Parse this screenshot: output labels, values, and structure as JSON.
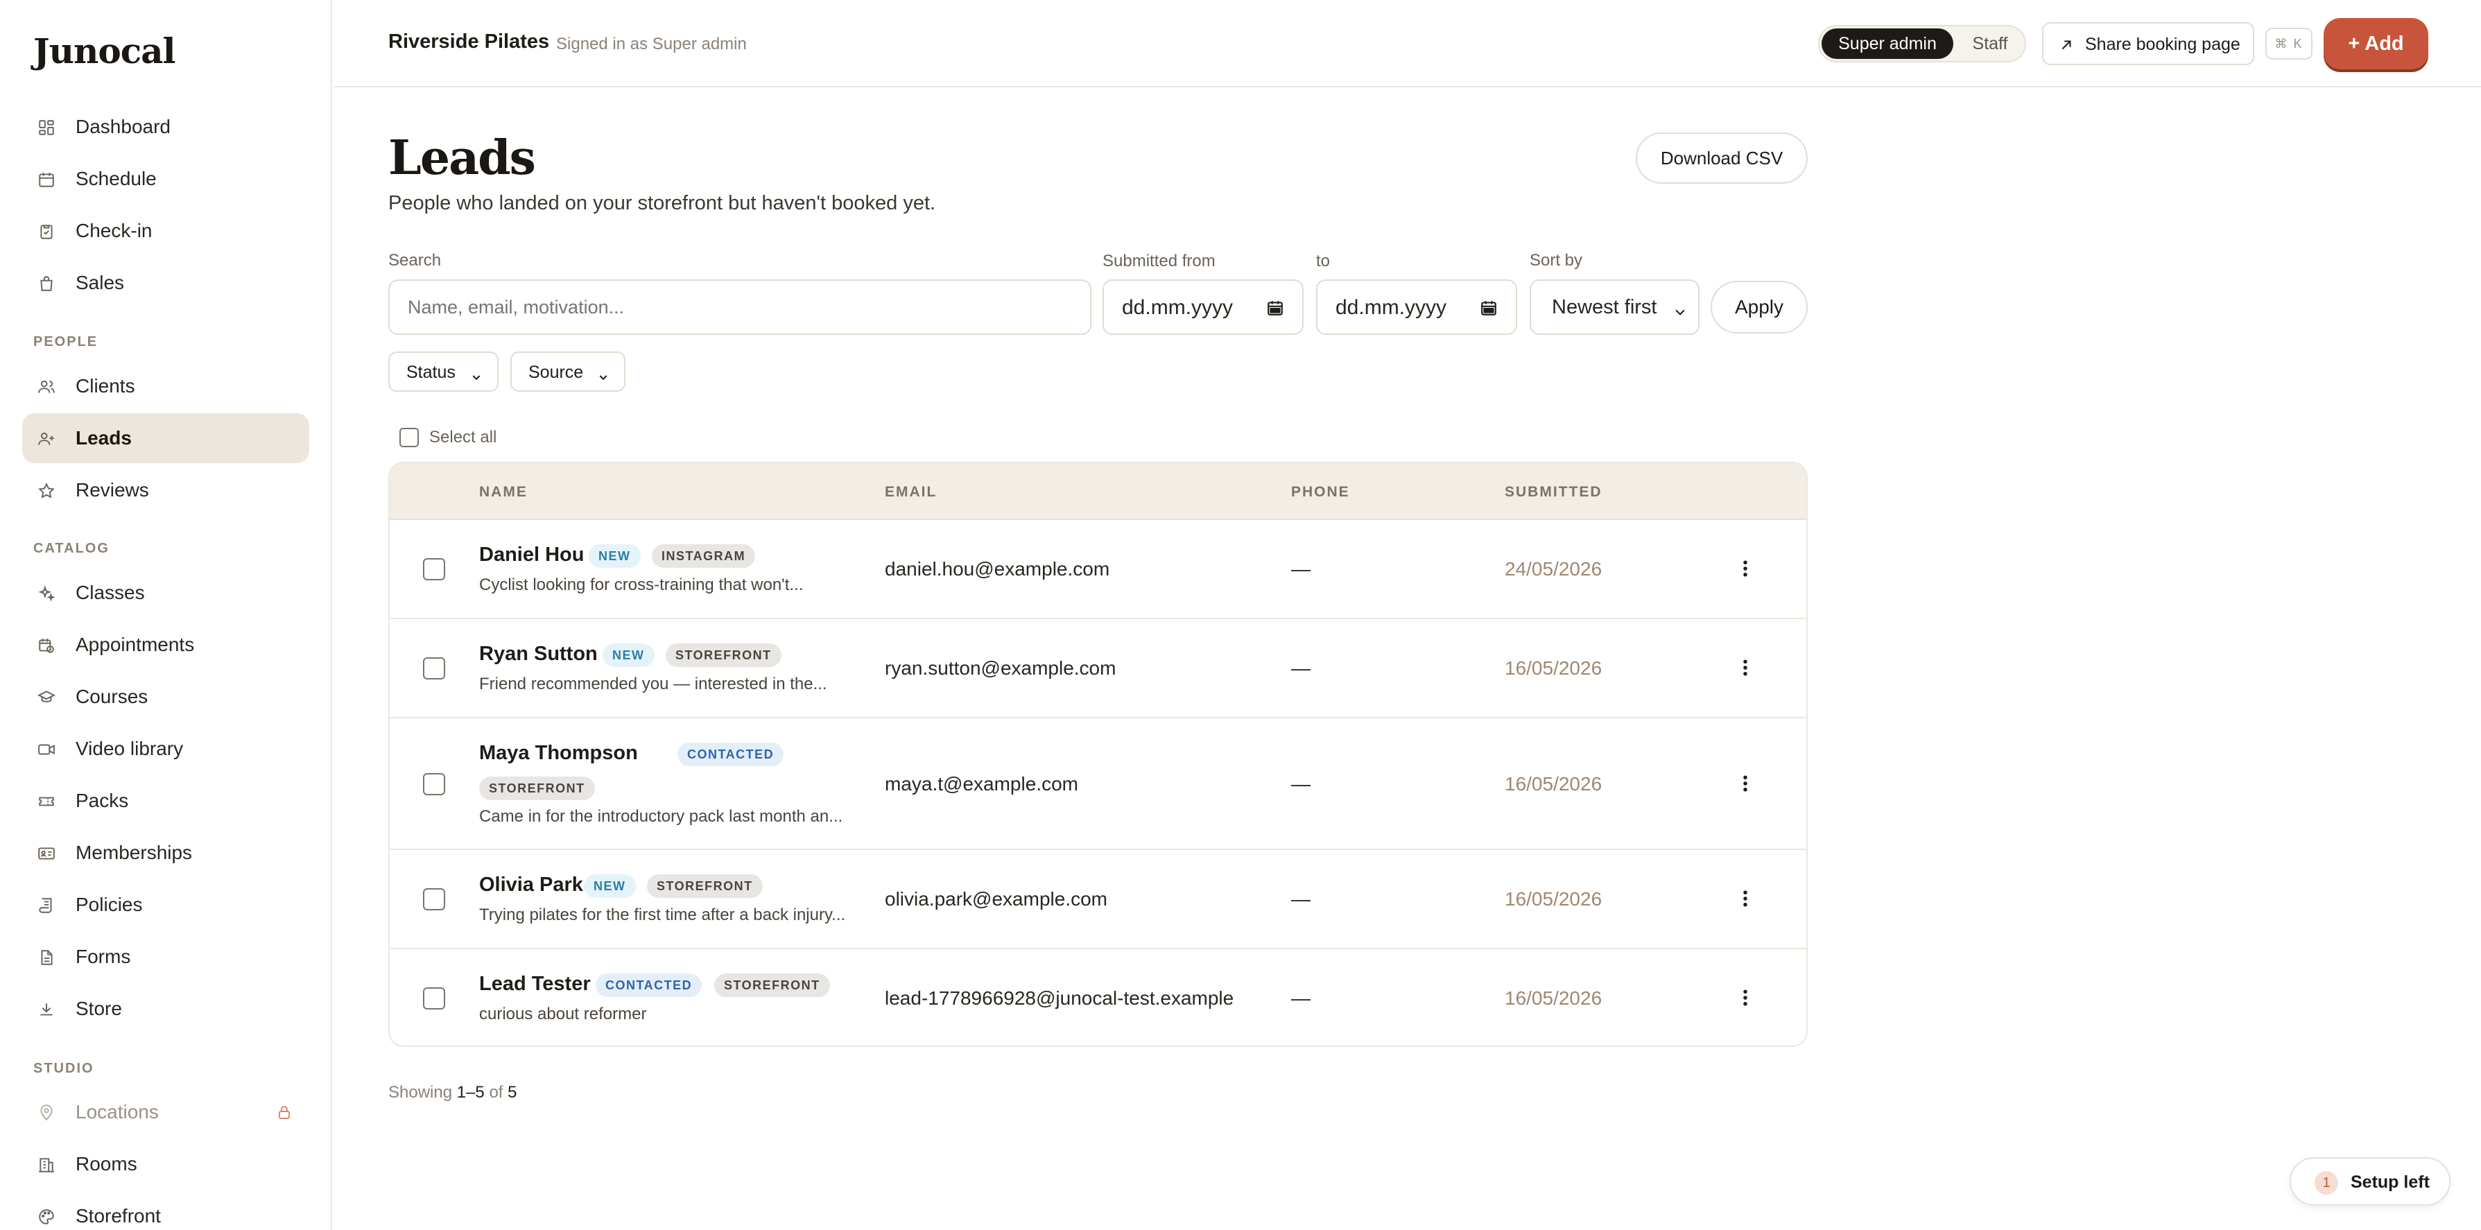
{
  "brand": {
    "logo": "Junocal",
    "accent": "#c8553b"
  },
  "sidebar": {
    "main": [
      {
        "label": "Dashboard",
        "icon": "dashboard-icon"
      },
      {
        "label": "Schedule",
        "icon": "calendar-icon"
      },
      {
        "label": "Check-in",
        "icon": "clipboard-check-icon"
      },
      {
        "label": "Sales",
        "icon": "bag-icon"
      }
    ],
    "people_label": "PEOPLE",
    "people": [
      {
        "label": "Clients",
        "icon": "users-icon"
      },
      {
        "label": "Leads",
        "icon": "user-plus-icon"
      },
      {
        "label": "Reviews",
        "icon": "star-icon"
      }
    ],
    "catalog_label": "CATALOG",
    "catalog": [
      {
        "label": "Classes",
        "icon": "sparkles-icon"
      },
      {
        "label": "Appointments",
        "icon": "calendar-clock-icon"
      },
      {
        "label": "Courses",
        "icon": "graduation-cap-icon"
      },
      {
        "label": "Video library",
        "icon": "video-icon"
      },
      {
        "label": "Packs",
        "icon": "ticket-icon"
      },
      {
        "label": "Memberships",
        "icon": "id-card-icon"
      },
      {
        "label": "Policies",
        "icon": "scroll-icon"
      },
      {
        "label": "Forms",
        "icon": "file-icon"
      },
      {
        "label": "Store",
        "icon": "download-icon"
      }
    ],
    "studio_label": "STUDIO",
    "studio": [
      {
        "label": "Locations",
        "icon": "map-pin-icon"
      },
      {
        "label": "Rooms",
        "icon": "building-icon"
      },
      {
        "label": "Storefront",
        "icon": "palette-icon"
      }
    ]
  },
  "header": {
    "studio_name": "Riverside Pilates",
    "signed_in": "Signed in as Super admin",
    "role_active": "Super admin",
    "role_other": "Staff",
    "share_label": "Share booking page",
    "shortcut": "⌘ K",
    "add_label": "+ Add"
  },
  "page": {
    "title": "Leads",
    "subtitle": "People who landed on your storefront but haven't booked yet.",
    "download_label": "Download CSV"
  },
  "filters": {
    "search_label": "Search",
    "search_placeholder": "Name, email, motivation...",
    "from_label": "Submitted from",
    "from_value": "dd.mm.yyyy",
    "to_label": "to",
    "to_value": "dd.mm.yyyy",
    "sort_label": "Sort by",
    "sort_value": "Newest first",
    "apply_label": "Apply",
    "status_label": "Status",
    "source_label": "Source",
    "select_all": "Select all"
  },
  "table": {
    "columns": [
      "NAME",
      "EMAIL",
      "PHONE",
      "SUBMITTED"
    ],
    "rows": [
      {
        "name": "Daniel Hou",
        "status": "NEW",
        "source": "INSTAGRAM",
        "motivation": "Cyclist looking for cross-training that won't...",
        "email": "daniel.hou@example.com",
        "phone": "—",
        "submitted": "24/05/2026"
      },
      {
        "name": "Ryan Sutton",
        "status": "NEW",
        "source": "STOREFRONT",
        "motivation": "Friend recommended you — interested in the...",
        "email": "ryan.sutton@example.com",
        "phone": "—",
        "submitted": "16/05/2026"
      },
      {
        "name": "Maya Thompson",
        "status": "CONTACTED",
        "source": "STOREFRONT",
        "motivation": "Came in for the introductory pack last month an...",
        "email": "maya.t@example.com",
        "phone": "—",
        "submitted": "16/05/2026"
      },
      {
        "name": "Olivia Park",
        "status": "NEW",
        "source": "STOREFRONT",
        "motivation": "Trying pilates for the first time after a back injury...",
        "email": "olivia.park@example.com",
        "phone": "—",
        "submitted": "16/05/2026"
      },
      {
        "name": "Lead Tester",
        "status": "CONTACTED",
        "source": "STOREFRONT",
        "motivation": "curious about reformer",
        "email": "lead-1778966928@junocal-test.example",
        "phone": "—",
        "submitted": "16/05/2026"
      }
    ]
  },
  "pagination": {
    "prefix": "Showing",
    "range": "1–5",
    "of": "of",
    "total": "5"
  },
  "setup": {
    "count": "1",
    "label": "Setup left"
  }
}
